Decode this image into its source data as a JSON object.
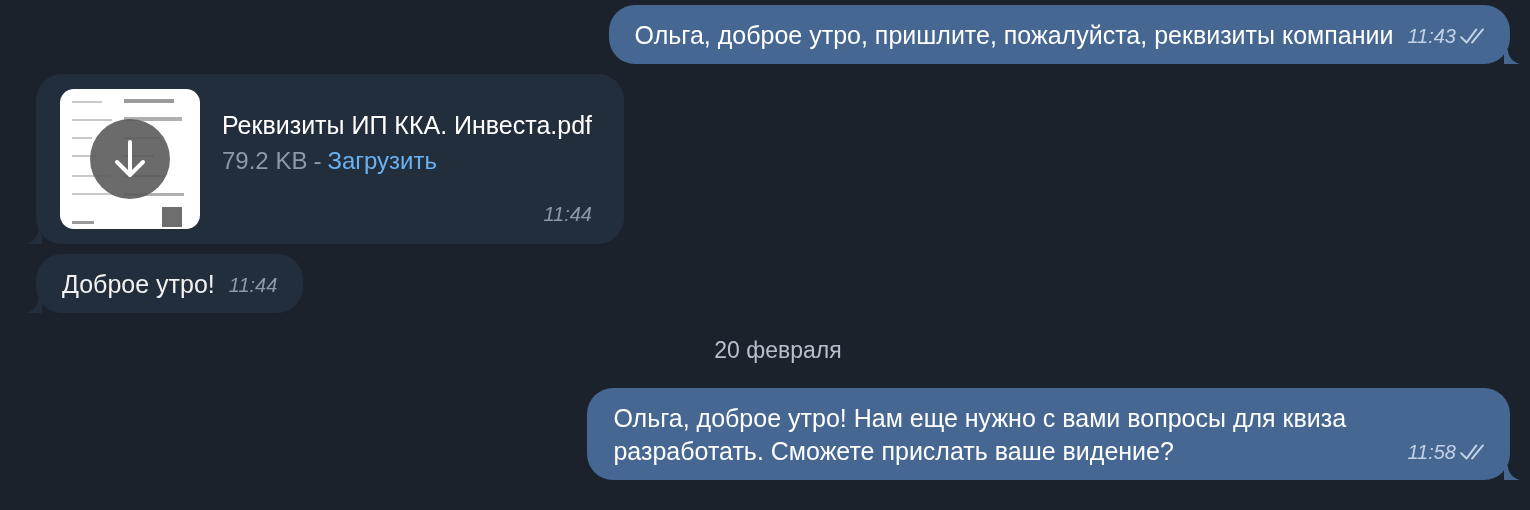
{
  "messages": [
    {
      "kind": "text",
      "outgoing": true,
      "text": "Ольга, доброе утро, пришлите, пожалуйста, реквизиты компании",
      "time": "11:43",
      "read": true
    },
    {
      "kind": "file",
      "file_name": "Реквизиты ИП ККА. Инвеста.pdf",
      "size": "79.2 KB",
      "separator": "-",
      "action": "Загрузить",
      "time": "11:44"
    },
    {
      "kind": "text",
      "outgoing": false,
      "text": "Доброе утро!",
      "time": "11:44"
    },
    {
      "kind": "date",
      "text": "20 февраля"
    },
    {
      "kind": "text",
      "outgoing": true,
      "text": "Ольга, доброе утро! Нам еще нужно с вами вопросы для квиза разработать. Сможете прислать ваше видение?",
      "time": "11:58",
      "read": true
    }
  ]
}
